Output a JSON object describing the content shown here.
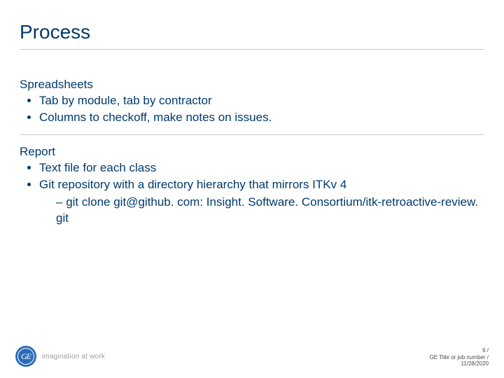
{
  "title": "Process",
  "sections": {
    "spreadsheets": {
      "heading": "Spreadsheets",
      "bullets": {
        "b0": "Tab by module, tab by contractor",
        "b1": "Columns to checkoff, make notes on issues."
      }
    },
    "report": {
      "heading": "Report",
      "bullets": {
        "b0": "Text file for each class",
        "b1": "Git repository with a directory hierarchy that mirrors ITKv 4",
        "sub": {
          "s0": "git clone git@github. com: Insight. Software. Consortium/itk-retroactive-review. git"
        }
      }
    }
  },
  "footer": {
    "logo_monogram": "GE",
    "tagline": "imagination at work",
    "page_line": "6 /",
    "meta_line": "GE Title or job number /",
    "date_line": "11/28/2020"
  }
}
